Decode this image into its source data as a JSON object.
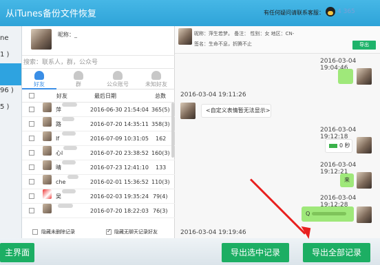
{
  "app": {
    "title": "从iTunes备份文件恢复",
    "help_text": "有任何疑问请联系客服：",
    "qq_number": "4 365"
  },
  "left_panel": {
    "items": [
      {
        "label": "ne"
      },
      {
        "label": "1 )"
      },
      {
        "label": ""
      },
      {
        "label": "96 )"
      },
      {
        "label": "5 )"
      }
    ],
    "back_button": "主界面"
  },
  "contacts": {
    "profile_nick": "昵称：_",
    "search_placeholder": "搜索：联系人，群，公众号",
    "tabs": [
      {
        "label": "好友"
      },
      {
        "label": "群"
      },
      {
        "label": "公众账号"
      },
      {
        "label": "未知好友"
      }
    ],
    "columns": {
      "name": "好友",
      "date": "最后日期",
      "total": "总数"
    },
    "rows": [
      {
        "name": "萍",
        "date": "2016-06-30 21:54:04",
        "total": "365(5)"
      },
      {
        "name": "路",
        "date": "2016-07-20 14:35:11",
        "total": "358(3)"
      },
      {
        "name": "If",
        "date": "2016-07-09 10:31:05",
        "total": "162"
      },
      {
        "name": "心l",
        "date": "2016-07-20 23:38:52",
        "total": "160(3)"
      },
      {
        "name": "晴",
        "date": "2016-07-23 12:41:10",
        "total": "133"
      },
      {
        "name": "che",
        "date": "2016-02-01 15:36:52",
        "total": "110(3)"
      },
      {
        "name": "吴",
        "date": "2016-02-03 19:35:24",
        "total": "79(4)"
      },
      {
        "name": "",
        "date": "2016-07-20 18:22:03",
        "total": "76(3)"
      }
    ],
    "option_hide_deleted": "隐藏未删除记录",
    "option_hide_empty": "隐藏无聊天记录好友"
  },
  "chat": {
    "header_line1": "昵称：萍生若梦。    备注：           性别：女  地区：CN-",
    "header_line2": "签名：生命不息，折腾不止",
    "export_small": "导出",
    "messages": [
      {
        "time": "2016-03-04 19:04:46",
        "side": "right",
        "text": ""
      },
      {
        "time": "2016-03-04 19:11:26",
        "side": "left",
        "text": "<自定义表情暂无法显示>"
      },
      {
        "time": "2016-03-04 19:12:18",
        "side": "right",
        "text": "0 秒"
      },
      {
        "time": "2016-03-04 19:12:21",
        "side": "right",
        "text": "来"
      },
      {
        "time": "2016-03-04 19:12:28",
        "side": "right",
        "text": "Q"
      },
      {
        "time": "2016-03-04 19:19:46",
        "side": "left",
        "text": ""
      }
    ]
  },
  "footer": {
    "export_selected": "导出选中记录",
    "export_all": "导出全部记录"
  },
  "colors": {
    "title_bar": "#2ea3d8",
    "accent_green": "#1cae63",
    "bubble_green": "#9fe87a",
    "selection_blue": "#2ea3e0",
    "annotation_red": "#e8201f"
  }
}
